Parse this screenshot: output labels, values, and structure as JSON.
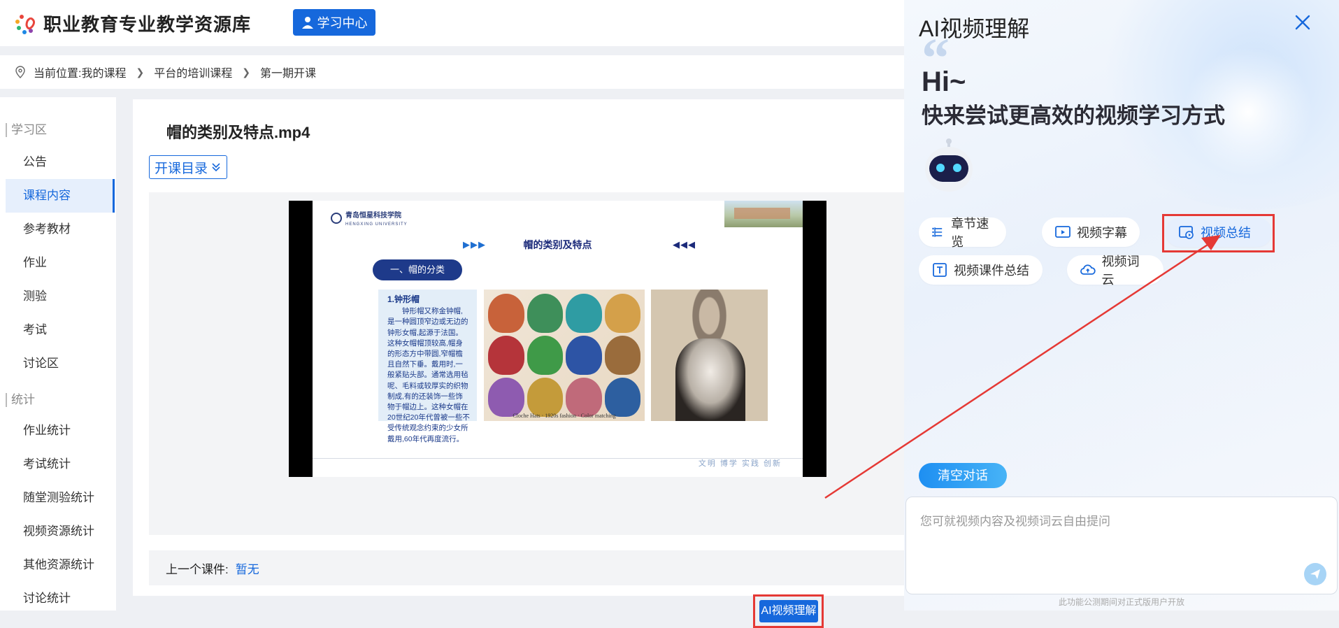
{
  "header": {
    "site_title": "职业教育专业教学资源库",
    "study_center_label": "学习中心"
  },
  "breadcrumb": {
    "prefix": "当前位置:",
    "items": [
      "我的课程",
      "平台的培训课程",
      "第一期开课"
    ]
  },
  "sidebar": {
    "sections": [
      {
        "title": "学习区",
        "items": [
          "公告",
          "课程内容",
          "参考教材",
          "作业",
          "测验",
          "考试",
          "讨论区"
        ]
      },
      {
        "title": "统计",
        "items": [
          "作业统计",
          "考试统计",
          "随堂测验统计",
          "视频资源统计",
          "其他资源统计",
          "讨论统计"
        ]
      }
    ],
    "active_item": "课程内容"
  },
  "main": {
    "video_title": "帽的类别及特点.mp4",
    "catalog_button": "开课目录",
    "ai_button": "AI视频理解",
    "prev_label": "上一个课件:",
    "prev_value": "暂无"
  },
  "slide": {
    "school_name": "青岛恒星科技学院",
    "school_name_en": "HENGXING UNIVERSITY",
    "heading": "帽的类别及特点",
    "tag": "一、帽的分类",
    "subheading": "1.钟形帽",
    "body": "钟形帽又称金钟帽,是一种圆顶窄边或无边的钟形女帽,起源于法国。这种女帽帽顶较高,帽身的形态方中带圆,窄帽檐且自然下垂。戴用时,一般紧贴头部。通常选用毡呢、毛料或较厚实的织物制成,有的还装饰一些饰物于帽边上。这种女帽在20世纪20年代曾被一些不受传统观念约束的少女所戴用,60年代再度流行。",
    "image_caption": "Cloche Hats · 1920s fashion · Color matching",
    "footer_motto": "文明 博学 实践 创新"
  },
  "ai_panel": {
    "title": "AI视频理解",
    "greeting": "Hi~",
    "subtitle": "快来尝试更高效的视频学习方式",
    "chips": [
      {
        "label": "章节速览",
        "icon": "list-icon"
      },
      {
        "label": "视频字幕",
        "icon": "video-subtitle-icon"
      },
      {
        "label": "视频总结",
        "icon": "video-summary-icon",
        "selected": true
      },
      {
        "label": "视频课件总结",
        "icon": "text-box-icon"
      },
      {
        "label": "视频词云",
        "icon": "cloud-icon"
      }
    ],
    "clear_button": "清空对话",
    "input_placeholder": "您可就视频内容及视频词云自由提问",
    "footnote": "此功能公测期间对正式版用户开放"
  },
  "colors": {
    "primary": "#1668dc",
    "highlight": "#e53935"
  }
}
